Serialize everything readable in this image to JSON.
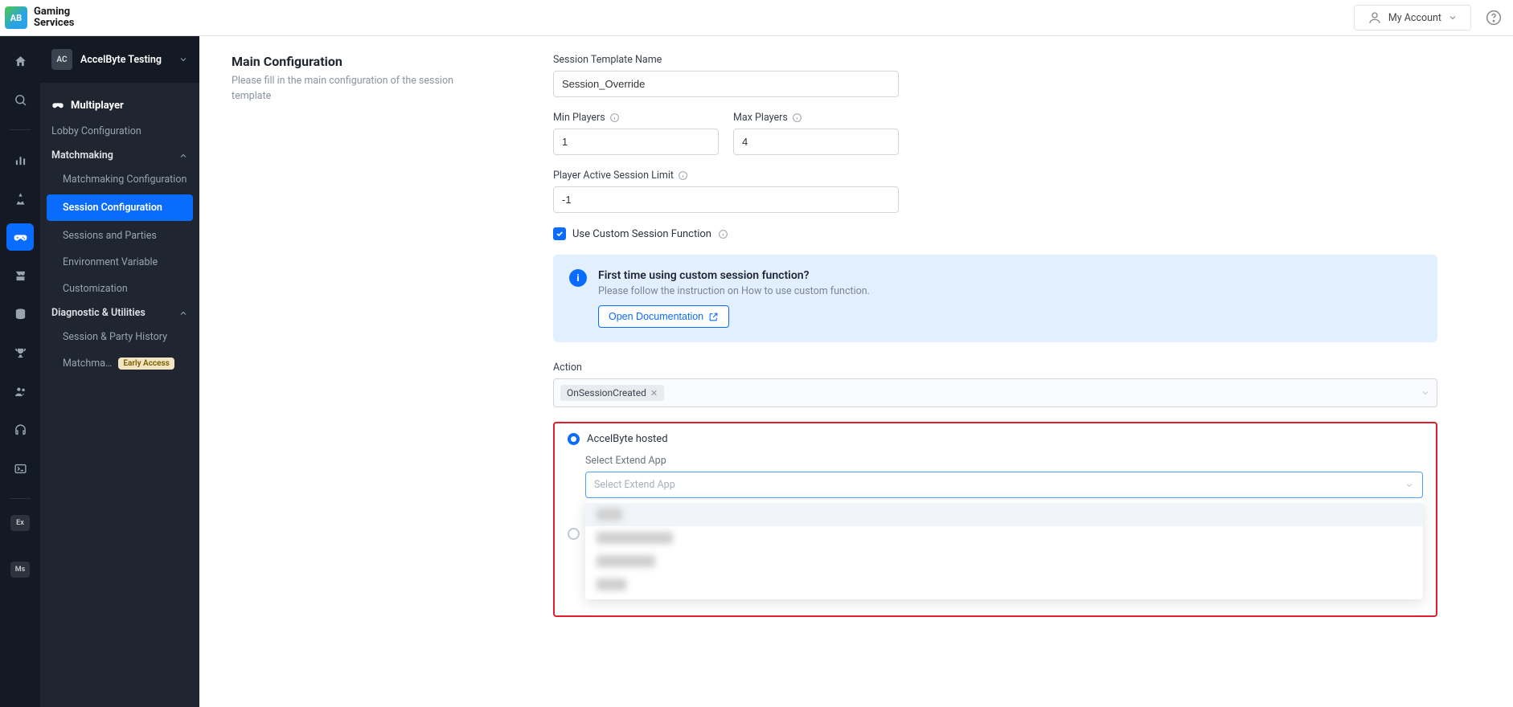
{
  "brand": {
    "logo_text": "AB",
    "name_line1": "Gaming",
    "name_line2": "Services"
  },
  "account": {
    "label": "My Account"
  },
  "workspace": {
    "avatar": "AC",
    "name": "AccelByte Testing"
  },
  "sidebar": {
    "section_title": "Multiplayer",
    "lobby": "Lobby Configuration",
    "matchmaking_group": "Matchmaking",
    "matchmaking_config": "Matchmaking Configuration",
    "session_config": "Session Configuration",
    "sessions_parties": "Sessions and Parties",
    "env_var": "Environment Variable",
    "customization": "Customization",
    "diag_group": "Diagnostic & Utilities",
    "session_history": "Session & Party History",
    "matchma": "Matchma…",
    "early_access": "Early Access"
  },
  "rail_badges": {
    "ex": "Ex",
    "ms": "Ms"
  },
  "main_config": {
    "heading": "Main Configuration",
    "sub": "Please fill in the main configuration of the session template"
  },
  "form": {
    "session_template_label": "Session Template Name",
    "session_template_value": "Session_Override",
    "min_players_label": "Min Players",
    "min_players_value": "1",
    "max_players_label": "Max Players",
    "max_players_value": "4",
    "active_limit_label": "Player Active Session Limit",
    "active_limit_value": "-1",
    "use_custom_label": "Use Custom Session Function",
    "action_label": "Action",
    "action_tag": "OnSessionCreated",
    "ab_hosted_label": "AccelByte hosted",
    "select_extend_label": "Select Extend App",
    "select_extend_placeholder": "Select Extend App"
  },
  "info": {
    "title": "First time using custom session function?",
    "body": "Please follow the instruction on How to use custom function.",
    "button": "Open Documentation"
  },
  "dropdown": {
    "opt1": "aug-0",
    "opt2": "matchmaker-ovr",
    "opt3": "mm-override",
    "opt4": "test01"
  }
}
